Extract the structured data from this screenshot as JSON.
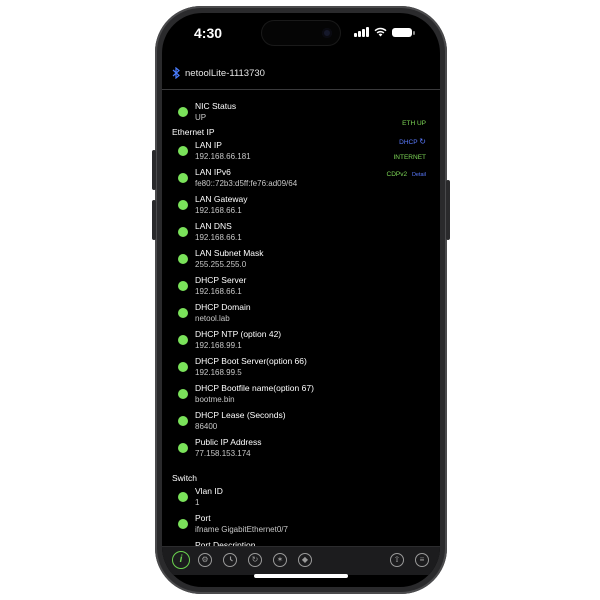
{
  "status_bar": {
    "time": "4:30"
  },
  "header": {
    "device_name": "netoolLite-1113730"
  },
  "side_status": {
    "eth": "ETH UP",
    "dhcp": "DHCP",
    "dhcp_icon": "refresh-icon",
    "internet": "INTERNET",
    "cdp": "CDPv2",
    "detail": "Detail"
  },
  "sections": {
    "ethernet_ip": "Ethernet IP",
    "switch": "Switch"
  },
  "nic": {
    "label": "NIC Status",
    "value": "UP"
  },
  "ethernet_items": [
    {
      "label": "LAN IP",
      "value": "192.168.66.181"
    },
    {
      "label": "LAN IPv6",
      "value": "fe80::72b3:d5ff:fe76:ad09/64"
    },
    {
      "label": "LAN Gateway",
      "value": "192.168.66.1"
    },
    {
      "label": "LAN DNS",
      "value": "192.168.66.1"
    },
    {
      "label": "LAN Subnet Mask",
      "value": "255.255.255.0"
    },
    {
      "label": "DHCP Server",
      "value": "192.168.66.1"
    },
    {
      "label": "DHCP Domain",
      "value": "netool.lab"
    },
    {
      "label": "DHCP NTP (option 42)",
      "value": "192.168.99.1"
    },
    {
      "label": "DHCP Boot Server(option 66)",
      "value": "192.168.99.5"
    },
    {
      "label": "DHCP Bootfile name(option 67)",
      "value": "bootme.bin"
    },
    {
      "label": "DHCP Lease (Seconds)",
      "value": "86400"
    },
    {
      "label": "Public IP Address",
      "value": "77.158.153.174"
    }
  ],
  "switch_items": [
    {
      "label": "Vlan ID",
      "value": "1"
    },
    {
      "label": "Port",
      "value": "ifname GigabitEthernet0/7"
    },
    {
      "label": "Port Description",
      "value": ""
    }
  ],
  "toolbar": {
    "icons": [
      "info-icon",
      "settings-icon",
      "clock-icon",
      "refresh-icon",
      "bug-icon",
      "tag-icon",
      "share-icon",
      "list-icon"
    ]
  },
  "colors": {
    "accent_green": "#7ae25a",
    "eth_up": "#7ed957",
    "dhcp_blue": "#5b7bff",
    "background": "#000000"
  }
}
